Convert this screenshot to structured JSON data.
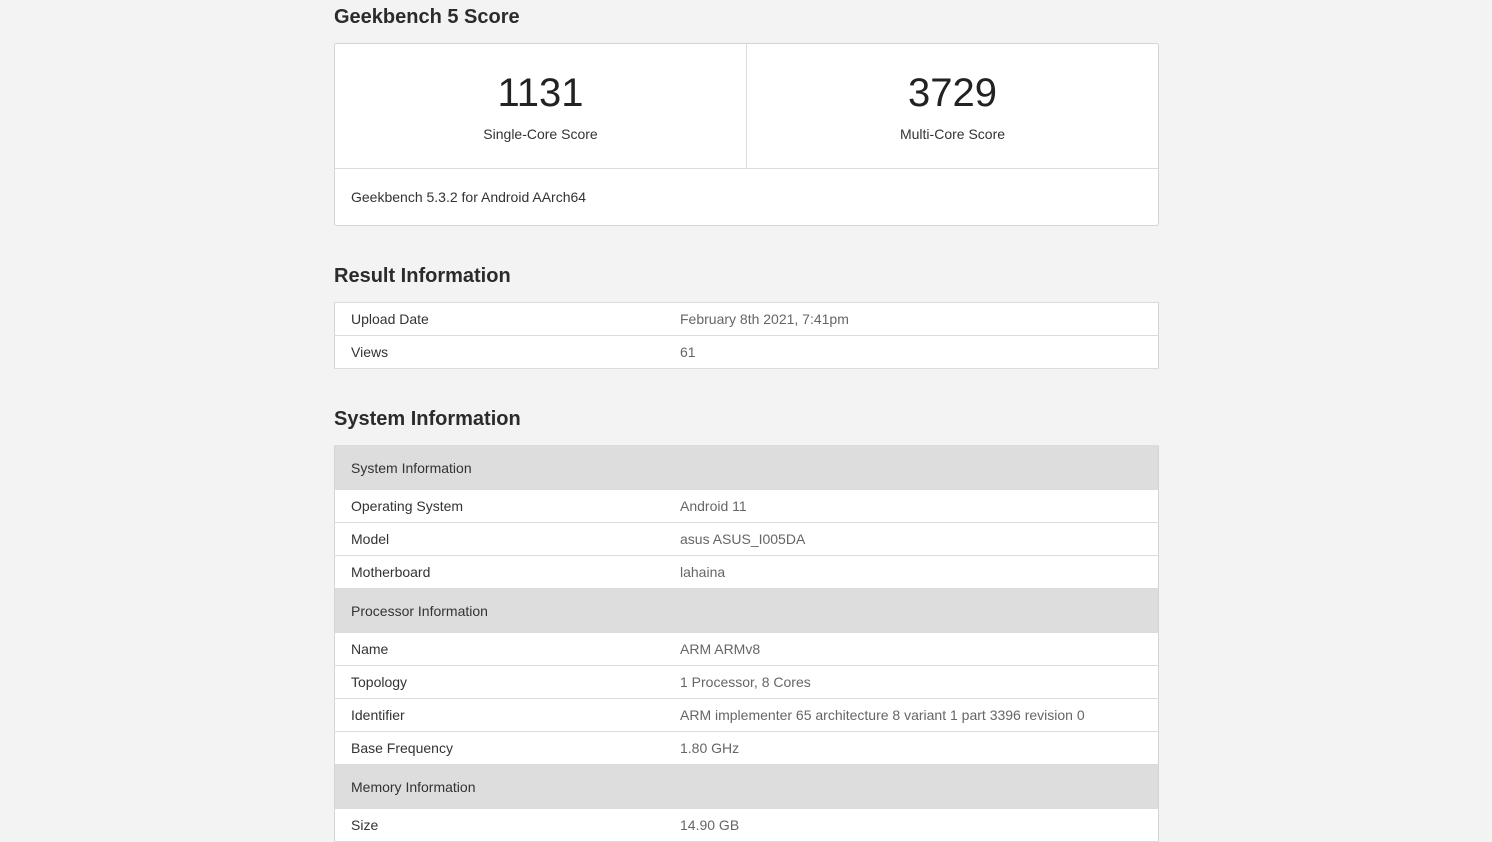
{
  "score_section": {
    "title": "Geekbench 5 Score",
    "single_core": {
      "value": "1131",
      "label": "Single-Core Score"
    },
    "multi_core": {
      "value": "3729",
      "label": "Multi-Core Score"
    },
    "version": "Geekbench 5.3.2 for Android AArch64"
  },
  "result_section": {
    "title": "Result Information",
    "rows": [
      {
        "name": "Upload Date",
        "value": "February 8th 2021, 7:41pm"
      },
      {
        "name": "Views",
        "value": "61"
      }
    ]
  },
  "system_section": {
    "title": "System Information",
    "groups": [
      {
        "header": "System Information",
        "rows": [
          {
            "name": "Operating System",
            "value": "Android 11"
          },
          {
            "name": "Model",
            "value": "asus ASUS_I005DA"
          },
          {
            "name": "Motherboard",
            "value": "lahaina"
          }
        ]
      },
      {
        "header": "Processor Information",
        "rows": [
          {
            "name": "Name",
            "value": "ARM ARMv8"
          },
          {
            "name": "Topology",
            "value": "1 Processor, 8 Cores"
          },
          {
            "name": "Identifier",
            "value": "ARM implementer 65 architecture 8 variant 1 part 3396 revision 0"
          },
          {
            "name": "Base Frequency",
            "value": "1.80 GHz"
          }
        ]
      },
      {
        "header": "Memory Information",
        "rows": [
          {
            "name": "Size",
            "value": "14.90 GB"
          }
        ]
      }
    ]
  }
}
